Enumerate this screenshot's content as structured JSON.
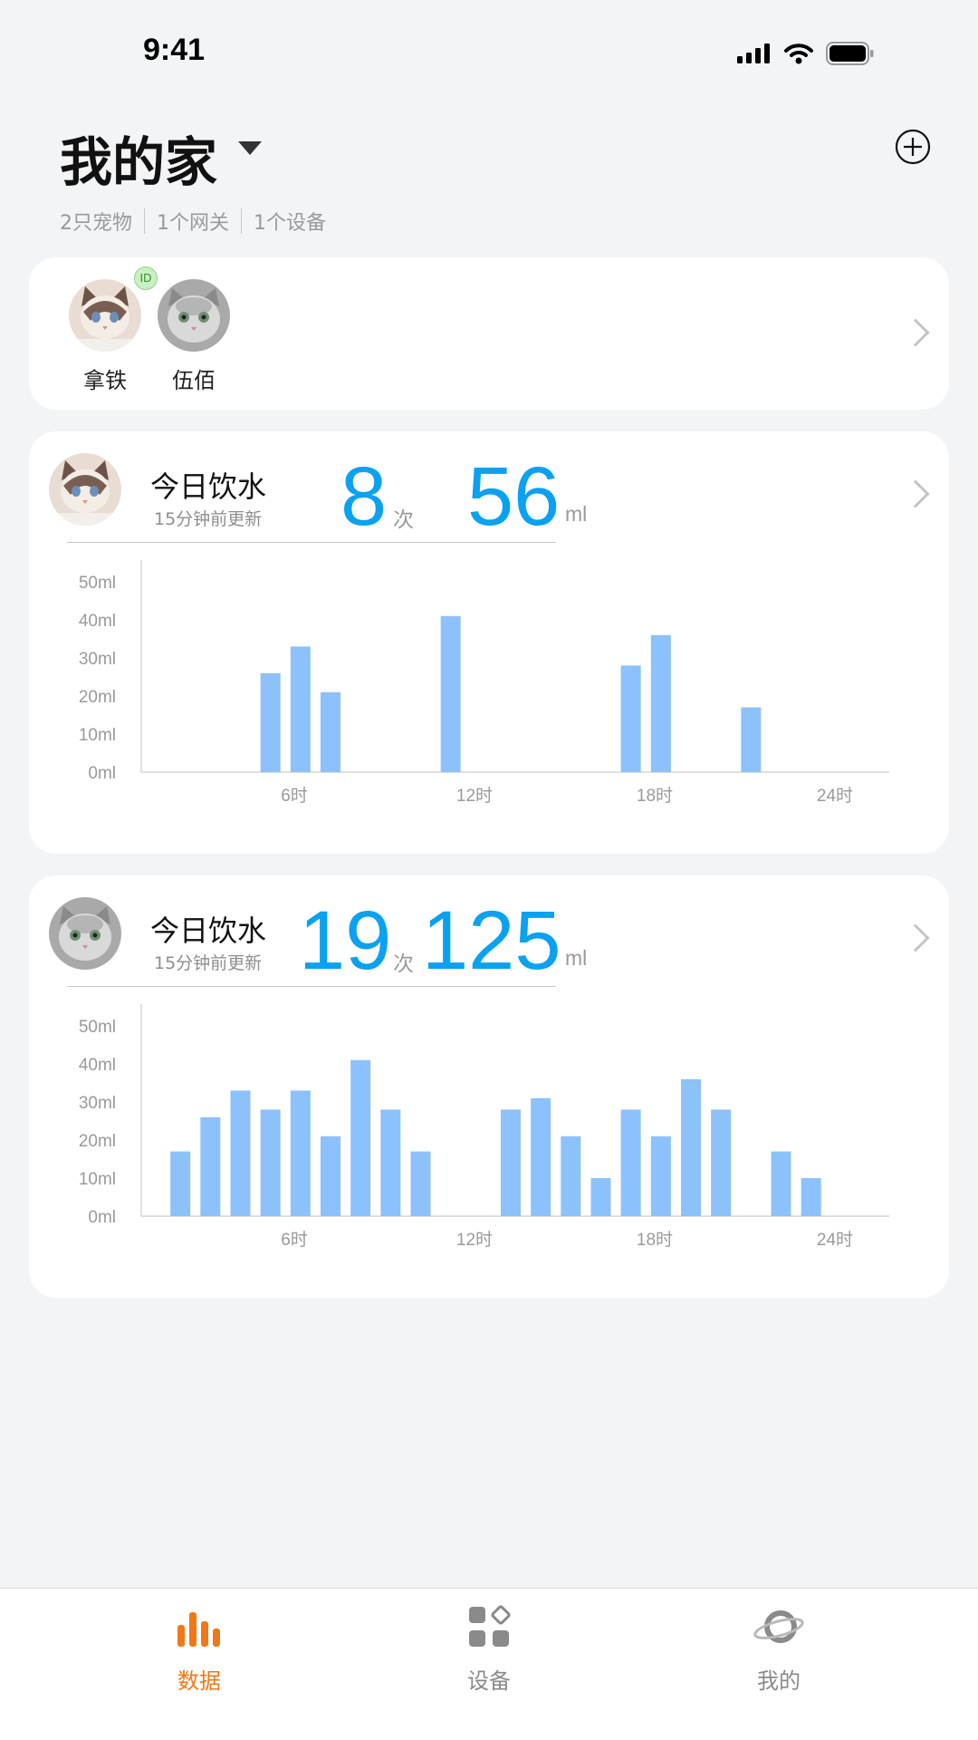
{
  "status_bar": {
    "time": "9:41"
  },
  "header": {
    "title": "我的家",
    "summary": [
      "2只宠物",
      "1个网关",
      "1个设备"
    ]
  },
  "pets": {
    "badge": "ID",
    "items": [
      {
        "name": "拿铁"
      },
      {
        "name": "伍佰"
      }
    ]
  },
  "drink_cards": [
    {
      "title": "今日饮水",
      "updated": "15分钟前更新",
      "count": "8",
      "count_unit": "次",
      "volume": "56",
      "volume_unit": "ml"
    },
    {
      "title": "今日饮水",
      "updated": "15分钟前更新",
      "count": "19",
      "count_unit": "次",
      "volume": "125",
      "volume_unit": "ml"
    }
  ],
  "chart_data": [
    {
      "type": "bar",
      "x_ticks": [
        "6时",
        "12时",
        "18时",
        "24时"
      ],
      "y_ticks": [
        "0ml",
        "10ml",
        "20ml",
        "30ml",
        "40ml",
        "50ml"
      ],
      "ylim": [
        0,
        50
      ],
      "xlim": [
        0,
        24
      ],
      "bars": [
        {
          "hour": 4,
          "value": 26
        },
        {
          "hour": 5,
          "value": 33
        },
        {
          "hour": 6,
          "value": 21
        },
        {
          "hour": 10,
          "value": 41
        },
        {
          "hour": 16,
          "value": 28
        },
        {
          "hour": 17,
          "value": 36
        },
        {
          "hour": 20,
          "value": 17
        }
      ]
    },
    {
      "type": "bar",
      "x_ticks": [
        "6时",
        "12时",
        "18时",
        "24时"
      ],
      "y_ticks": [
        "0ml",
        "10ml",
        "20ml",
        "30ml",
        "40ml",
        "50ml"
      ],
      "ylim": [
        0,
        50
      ],
      "xlim": [
        0,
        24
      ],
      "bars": [
        {
          "hour": 1,
          "value": 17
        },
        {
          "hour": 2,
          "value": 26
        },
        {
          "hour": 3,
          "value": 33
        },
        {
          "hour": 4,
          "value": 28
        },
        {
          "hour": 5,
          "value": 33
        },
        {
          "hour": 6,
          "value": 21
        },
        {
          "hour": 7,
          "value": 41
        },
        {
          "hour": 8,
          "value": 28
        },
        {
          "hour": 9,
          "value": 17
        },
        {
          "hour": 12,
          "value": 28
        },
        {
          "hour": 13,
          "value": 31
        },
        {
          "hour": 14,
          "value": 21
        },
        {
          "hour": 15,
          "value": 10
        },
        {
          "hour": 16,
          "value": 28
        },
        {
          "hour": 17,
          "value": 21
        },
        {
          "hour": 18,
          "value": 36
        },
        {
          "hour": 19,
          "value": 28
        },
        {
          "hour": 21,
          "value": 17
        },
        {
          "hour": 22,
          "value": 10
        }
      ]
    }
  ],
  "tabs": [
    {
      "label": "数据",
      "icon": "bar-chart-icon",
      "active": true
    },
    {
      "label": "设备",
      "icon": "devices-icon",
      "active": false
    },
    {
      "label": "我的",
      "icon": "planet-icon",
      "active": false
    }
  ],
  "colors": {
    "accent": "#0aa1f0",
    "bar": "#8cc1fb",
    "tab_active": "#f07818"
  }
}
